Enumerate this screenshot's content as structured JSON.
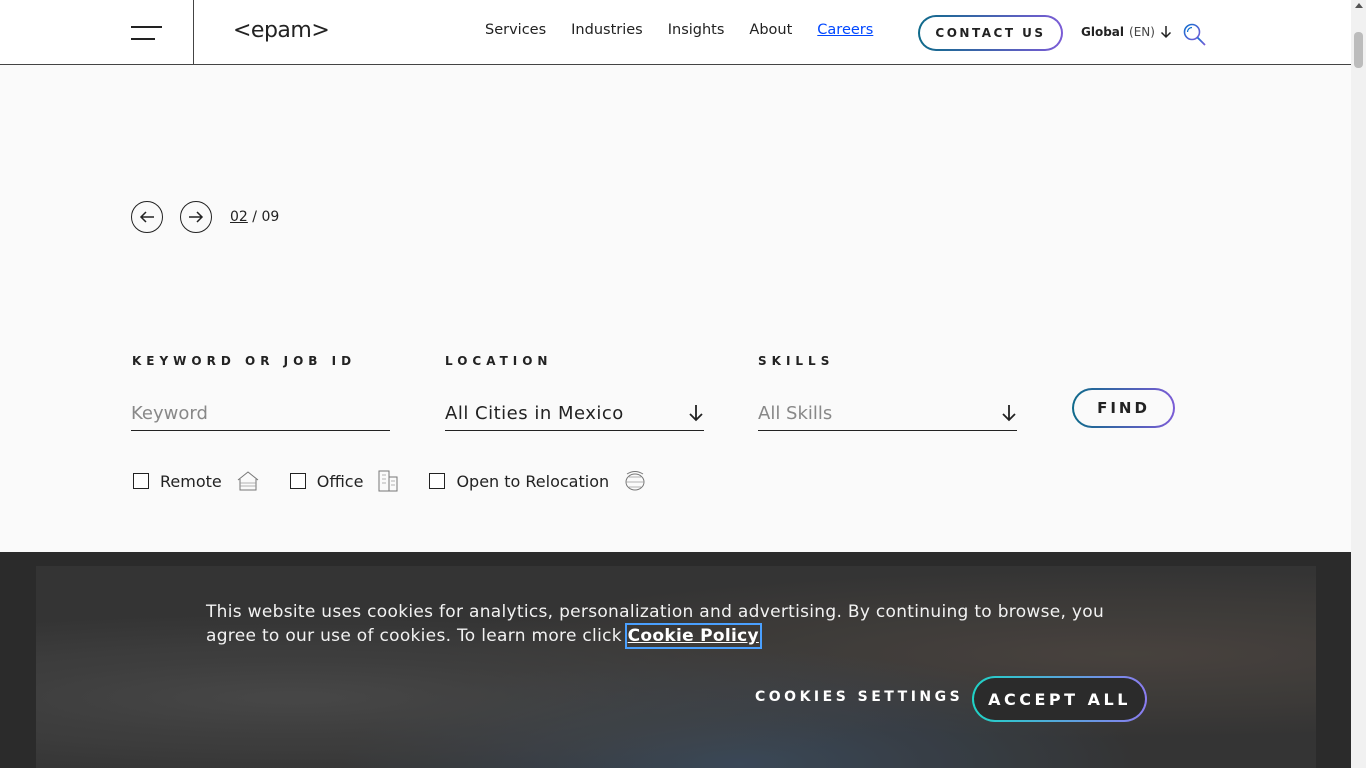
{
  "header": {
    "logo": "<epam>",
    "nav": [
      "Services",
      "Industries",
      "Insights",
      "About",
      "Careers"
    ],
    "active_nav": "Careers",
    "contact_label": "CONTACT US",
    "region_label": "Global",
    "region_lang": "(EN)"
  },
  "carousel": {
    "current": "02",
    "separator": "/",
    "total": "09"
  },
  "search": {
    "keyword_label": "KEYWORD OR JOB ID",
    "keyword_placeholder": "Keyword",
    "location_label": "LOCATION",
    "location_value": "All Cities in Mexico",
    "skills_label": "SKILLS",
    "skills_placeholder": "All Skills",
    "find_label": "FIND",
    "filters": [
      {
        "label": "Remote",
        "icon": "home-icon"
      },
      {
        "label": "Office",
        "icon": "building-icon"
      },
      {
        "label": "Open to Relocation",
        "icon": "globe-icon"
      }
    ]
  },
  "cookie": {
    "text": "This website uses cookies for analytics, personalization and advertising. By continuing to browse, you agree to our use of cookies. To learn more click ",
    "link": "Cookie Policy",
    "settings_label": "COOKIES SETTINGS",
    "accept_label": "ACCEPT ALL"
  }
}
